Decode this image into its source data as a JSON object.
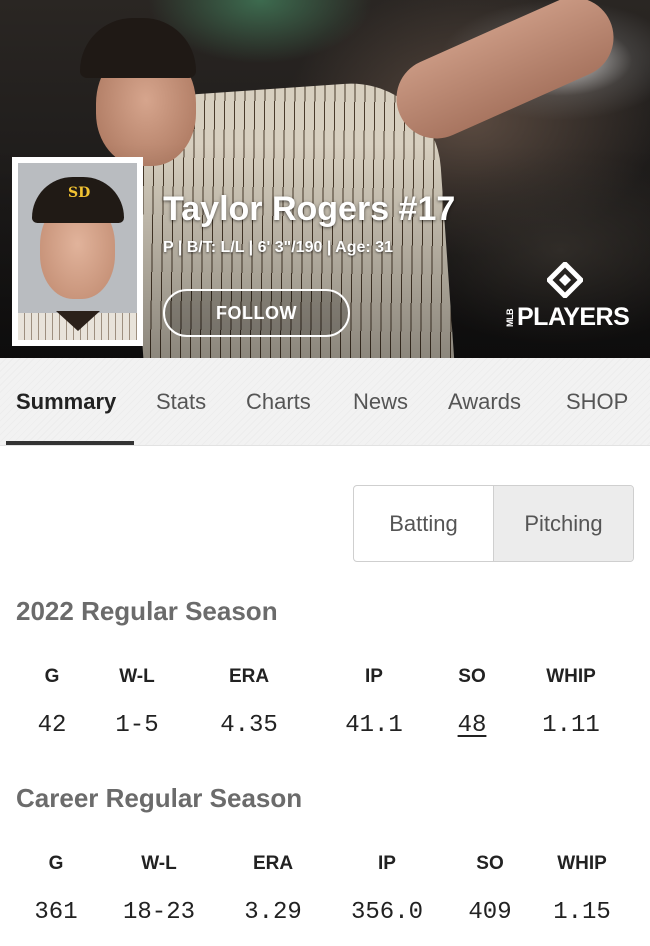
{
  "player": {
    "name": "Taylor Rogers #17",
    "meta": "P | B/T: L/L | 6' 3\"/190 | Age: 31",
    "follow_label": "FOLLOW",
    "cap_logo": "SD"
  },
  "brand": {
    "logo_text": "PLAYERS",
    "logo_prefix": "MLB"
  },
  "tabs": [
    {
      "label": "Summary",
      "active": true
    },
    {
      "label": "Stats",
      "active": false
    },
    {
      "label": "Charts",
      "active": false
    },
    {
      "label": "News",
      "active": false
    },
    {
      "label": "Awards",
      "active": false
    },
    {
      "label": "SHOP",
      "active": false
    }
  ],
  "toggle": {
    "batting": "Batting",
    "pitching": "Pitching",
    "selected": "Pitching"
  },
  "season": {
    "title": "2022 Regular Season",
    "headers": [
      "G",
      "W-L",
      "ERA",
      "IP",
      "SO",
      "WHIP"
    ],
    "values": [
      "42",
      "1-5",
      "4.35",
      "41.1",
      "48",
      "1.11"
    ]
  },
  "career": {
    "title": "Career Regular Season",
    "headers": [
      "G",
      "W-L",
      "ERA",
      "IP",
      "SO",
      "WHIP"
    ],
    "values": [
      "361",
      "18-23",
      "3.29",
      "356.0",
      "409",
      "1.15"
    ]
  },
  "colors": {
    "text_dark": "#222222",
    "section_gray": "#6b6b6b",
    "padres_gold": "#f1c232"
  }
}
